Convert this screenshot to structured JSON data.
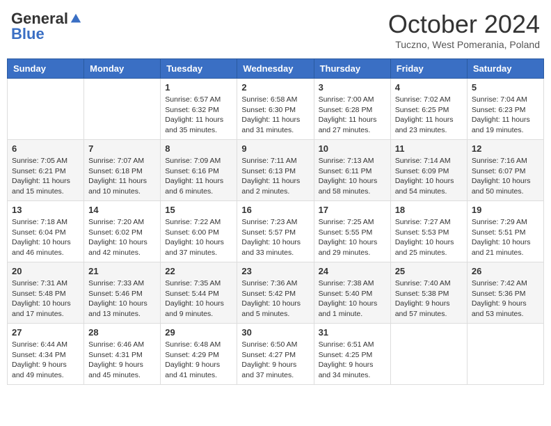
{
  "header": {
    "logo_general": "General",
    "logo_blue": "Blue",
    "month": "October 2024",
    "location": "Tuczno, West Pomerania, Poland"
  },
  "days_of_week": [
    "Sunday",
    "Monday",
    "Tuesday",
    "Wednesday",
    "Thursday",
    "Friday",
    "Saturday"
  ],
  "weeks": [
    [
      {
        "day": "",
        "content": ""
      },
      {
        "day": "",
        "content": ""
      },
      {
        "day": "1",
        "content": "Sunrise: 6:57 AM\nSunset: 6:32 PM\nDaylight: 11 hours and 35 minutes."
      },
      {
        "day": "2",
        "content": "Sunrise: 6:58 AM\nSunset: 6:30 PM\nDaylight: 11 hours and 31 minutes."
      },
      {
        "day": "3",
        "content": "Sunrise: 7:00 AM\nSunset: 6:28 PM\nDaylight: 11 hours and 27 minutes."
      },
      {
        "day": "4",
        "content": "Sunrise: 7:02 AM\nSunset: 6:25 PM\nDaylight: 11 hours and 23 minutes."
      },
      {
        "day": "5",
        "content": "Sunrise: 7:04 AM\nSunset: 6:23 PM\nDaylight: 11 hours and 19 minutes."
      }
    ],
    [
      {
        "day": "6",
        "content": "Sunrise: 7:05 AM\nSunset: 6:21 PM\nDaylight: 11 hours and 15 minutes."
      },
      {
        "day": "7",
        "content": "Sunrise: 7:07 AM\nSunset: 6:18 PM\nDaylight: 11 hours and 10 minutes."
      },
      {
        "day": "8",
        "content": "Sunrise: 7:09 AM\nSunset: 6:16 PM\nDaylight: 11 hours and 6 minutes."
      },
      {
        "day": "9",
        "content": "Sunrise: 7:11 AM\nSunset: 6:13 PM\nDaylight: 11 hours and 2 minutes."
      },
      {
        "day": "10",
        "content": "Sunrise: 7:13 AM\nSunset: 6:11 PM\nDaylight: 10 hours and 58 minutes."
      },
      {
        "day": "11",
        "content": "Sunrise: 7:14 AM\nSunset: 6:09 PM\nDaylight: 10 hours and 54 minutes."
      },
      {
        "day": "12",
        "content": "Sunrise: 7:16 AM\nSunset: 6:07 PM\nDaylight: 10 hours and 50 minutes."
      }
    ],
    [
      {
        "day": "13",
        "content": "Sunrise: 7:18 AM\nSunset: 6:04 PM\nDaylight: 10 hours and 46 minutes."
      },
      {
        "day": "14",
        "content": "Sunrise: 7:20 AM\nSunset: 6:02 PM\nDaylight: 10 hours and 42 minutes."
      },
      {
        "day": "15",
        "content": "Sunrise: 7:22 AM\nSunset: 6:00 PM\nDaylight: 10 hours and 37 minutes."
      },
      {
        "day": "16",
        "content": "Sunrise: 7:23 AM\nSunset: 5:57 PM\nDaylight: 10 hours and 33 minutes."
      },
      {
        "day": "17",
        "content": "Sunrise: 7:25 AM\nSunset: 5:55 PM\nDaylight: 10 hours and 29 minutes."
      },
      {
        "day": "18",
        "content": "Sunrise: 7:27 AM\nSunset: 5:53 PM\nDaylight: 10 hours and 25 minutes."
      },
      {
        "day": "19",
        "content": "Sunrise: 7:29 AM\nSunset: 5:51 PM\nDaylight: 10 hours and 21 minutes."
      }
    ],
    [
      {
        "day": "20",
        "content": "Sunrise: 7:31 AM\nSunset: 5:48 PM\nDaylight: 10 hours and 17 minutes."
      },
      {
        "day": "21",
        "content": "Sunrise: 7:33 AM\nSunset: 5:46 PM\nDaylight: 10 hours and 13 minutes."
      },
      {
        "day": "22",
        "content": "Sunrise: 7:35 AM\nSunset: 5:44 PM\nDaylight: 10 hours and 9 minutes."
      },
      {
        "day": "23",
        "content": "Sunrise: 7:36 AM\nSunset: 5:42 PM\nDaylight: 10 hours and 5 minutes."
      },
      {
        "day": "24",
        "content": "Sunrise: 7:38 AM\nSunset: 5:40 PM\nDaylight: 10 hours and 1 minute."
      },
      {
        "day": "25",
        "content": "Sunrise: 7:40 AM\nSunset: 5:38 PM\nDaylight: 9 hours and 57 minutes."
      },
      {
        "day": "26",
        "content": "Sunrise: 7:42 AM\nSunset: 5:36 PM\nDaylight: 9 hours and 53 minutes."
      }
    ],
    [
      {
        "day": "27",
        "content": "Sunrise: 6:44 AM\nSunset: 4:34 PM\nDaylight: 9 hours and 49 minutes."
      },
      {
        "day": "28",
        "content": "Sunrise: 6:46 AM\nSunset: 4:31 PM\nDaylight: 9 hours and 45 minutes."
      },
      {
        "day": "29",
        "content": "Sunrise: 6:48 AM\nSunset: 4:29 PM\nDaylight: 9 hours and 41 minutes."
      },
      {
        "day": "30",
        "content": "Sunrise: 6:50 AM\nSunset: 4:27 PM\nDaylight: 9 hours and 37 minutes."
      },
      {
        "day": "31",
        "content": "Sunrise: 6:51 AM\nSunset: 4:25 PM\nDaylight: 9 hours and 34 minutes."
      },
      {
        "day": "",
        "content": ""
      },
      {
        "day": "",
        "content": ""
      }
    ]
  ]
}
